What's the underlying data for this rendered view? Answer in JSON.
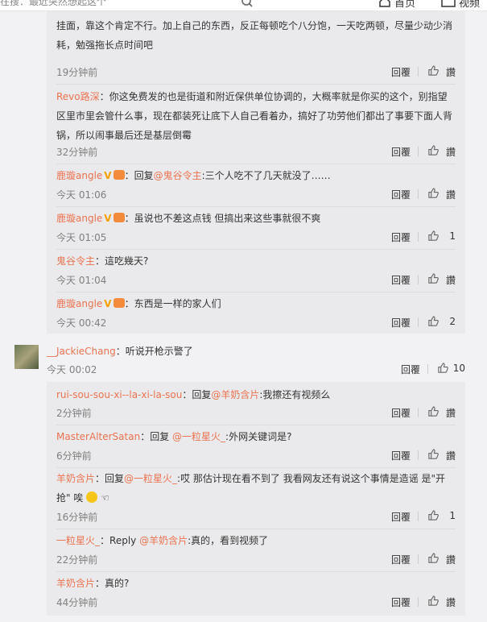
{
  "topbar": {
    "search_text": "在搜：最近突然想起这个",
    "home_label": "首页",
    "video_label": "视频"
  },
  "block1": {
    "replies": [
      {
        "text": "挂面，靠这个肯定不行。加上自己的东西，反正每顿吃个八分饱，一天吃两顿，尽量少动少消耗，勉强拖长点时间吧",
        "time": "19分钟前",
        "reply_label": "回覆",
        "like_label": "讚"
      },
      {
        "user": "Revo路深",
        "text": "：你这免费发的也是街道和附近保供单位协调的，大概率就是你买的这个，别指望区里市里会管什么事，现在都装死让底下人自己看着办，搞好了功劳他们都出了事要下面人背锅，所以闹事最后还是基层倒霉",
        "time": "32分钟前",
        "reply_label": "回覆",
        "like_label": "讚"
      },
      {
        "user": "鹿璇angle",
        "badge": "V",
        "prefix": "：回复",
        "mention": "@鬼谷令主",
        "text": ":三个人吃不了几天就没了……",
        "time": "今天 01:06",
        "reply_label": "回覆",
        "like_label": "讚"
      },
      {
        "user": "鹿璇angle",
        "badge": "V",
        "text": "：虽说也不差这点钱 但搞出来这些事就很不爽",
        "time": "今天 01:05",
        "reply_label": "回覆",
        "like_label": "1"
      },
      {
        "user": "鬼谷令主",
        "text": "：這吃幾天?",
        "time": "今天 01:04",
        "reply_label": "回覆",
        "like_label": "讚"
      },
      {
        "user": "鹿璇angle",
        "badge": "V",
        "text": "：东西是一样的家人们",
        "time": "今天 00:42",
        "reply_label": "回覆",
        "like_label": "2"
      }
    ]
  },
  "main_comment": {
    "user": "__JackieChang",
    "text": "：听说开枪示警了",
    "time": "今天 00:02",
    "reply_label": "回覆",
    "like_label": "10"
  },
  "block2": {
    "replies": [
      {
        "user": "rui-sou-sou-xi--la-xi-la-sou",
        "prefix": "：回复",
        "mention": "@羊奶含片",
        "text": ":我擦还有视频么",
        "time": "2分钟前",
        "reply_label": "回覆",
        "like_label": "讚"
      },
      {
        "user": "MasterAlterSatan",
        "prefix": "：回复 ",
        "mention": "@一粒星火_",
        "text": ":外网关键词是?",
        "time": "6分钟前",
        "reply_label": "回覆",
        "like_label": "讚"
      },
      {
        "user": "羊奶含片",
        "prefix": "：回复",
        "mention": "@一粒星火_",
        "text": ":哎 那估计现在看不到了 我看网友还有说这个事情是造谣 是\"开抢\" 唉",
        "time": "16分钟前",
        "reply_label": "回覆",
        "like_label": "1"
      },
      {
        "user": "一粒星火_",
        "prefix": "：Reply ",
        "mention": "@羊奶含片",
        "text": ":真的，看到视频了",
        "time": "22分钟前",
        "reply_label": "回覆",
        "like_label": "讚"
      },
      {
        "user": "羊奶含片",
        "text": "：真的?",
        "time": "44分钟前",
        "reply_label": "回覆",
        "like_label": "讚"
      }
    ]
  },
  "colors": {
    "username": "#eb7350",
    "vbadge": "#f4a000",
    "block_bg": "#eaeaec",
    "page_bg": "#f2f2f5"
  }
}
